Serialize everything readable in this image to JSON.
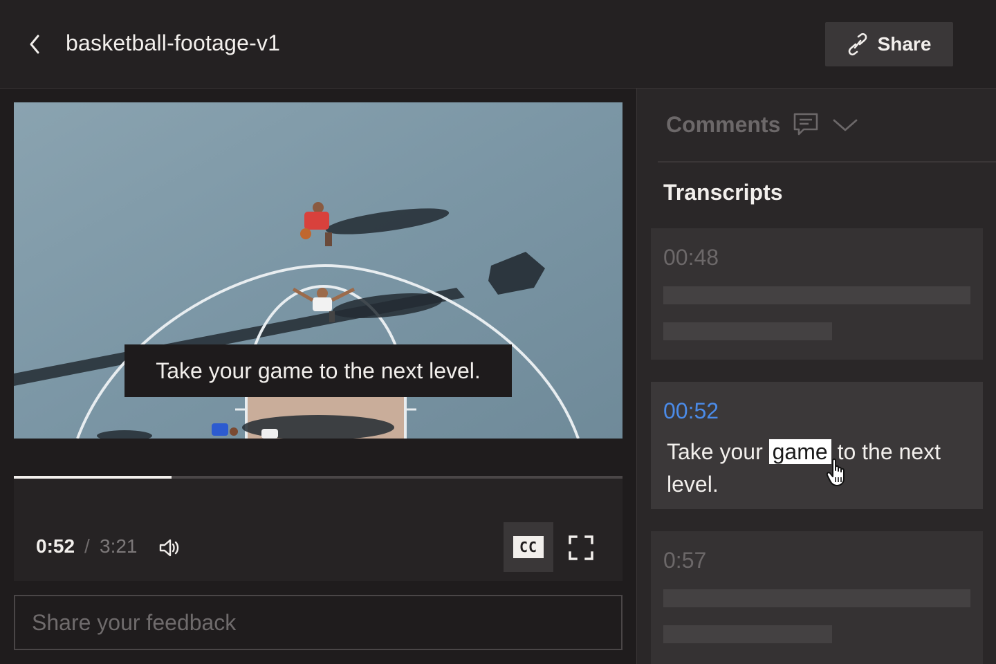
{
  "header": {
    "back_icon": "chevron-left-icon",
    "title": "basketball-footage-v1",
    "share_label": "Share",
    "share_icon": "link-icon"
  },
  "player": {
    "caption": "Take your game to the next level.",
    "current_time": "0:52",
    "separator": "/",
    "total_time": "3:21",
    "progress": 0.259,
    "cc_label": "CC",
    "volume_icon": "volume-icon",
    "fullscreen_icon": "fullscreen-icon"
  },
  "feedback": {
    "placeholder": "Share your feedback",
    "value": ""
  },
  "sidebar": {
    "comments_label": "Comments",
    "comments_icon": "comment-icon",
    "dropdown_icon": "chevron-down-icon",
    "transcripts_heading": "Transcripts",
    "cards": [
      {
        "time": "00:48",
        "state": "placeholder"
      },
      {
        "time": "00:52",
        "state": "active",
        "text_before": "Take your ",
        "highlight": "game",
        "text_after": " to the next level."
      },
      {
        "time": "0:57",
        "state": "placeholder"
      }
    ]
  },
  "colors": {
    "accent_blue": "#4b8be8",
    "background": "#1f1c1d",
    "panel": "#2a2728"
  }
}
